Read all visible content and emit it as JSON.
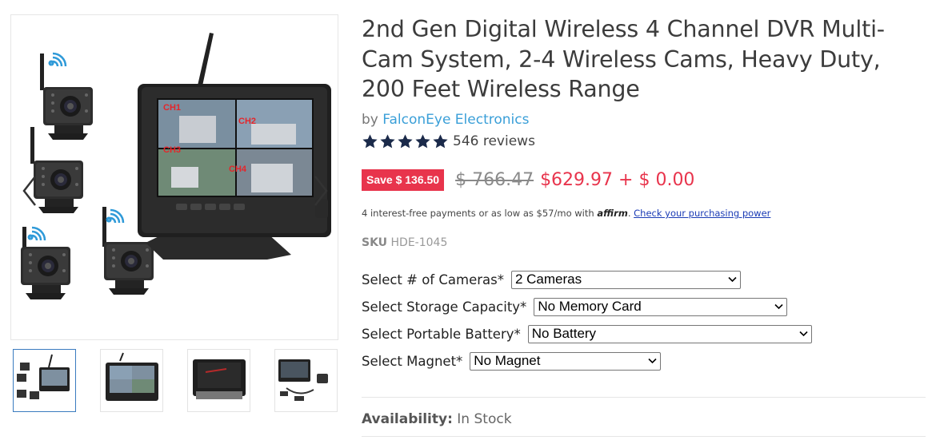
{
  "product": {
    "title": "2nd Gen Digital Wireless 4 Channel DVR Multi-Cam System, 2-4 Wireless Cams, Heavy Duty, 200 Feet Wireless Range",
    "vendor_prefix": "by",
    "vendor": "FalconEye Electronics",
    "rating": 5,
    "reviews": "546 reviews",
    "save_badge": "Save $ 136.50",
    "compare_price": "$ 766.47",
    "price": "$629.97 + $ 0.00",
    "affirm_text": "4 interest-free payments or as low as $57/mo with",
    "affirm_brand": "affirm",
    "affirm_link": "Check your purchasing power",
    "sku_label": "SKU",
    "sku_value": "HDE-1045",
    "availability_label": "Availability:",
    "availability_value": "In Stock"
  },
  "monitor_labels": [
    "CH1",
    "CH2",
    "CH3",
    "CH4"
  ],
  "options": [
    {
      "label": "Select # of Cameras*",
      "value": "2 Cameras"
    },
    {
      "label": "Select Storage Capacity*",
      "value": "No Memory Card"
    },
    {
      "label": "Select Portable Battery*",
      "value": "No Battery"
    },
    {
      "label": "Select Magnet*",
      "value": "No Magnet"
    }
  ],
  "thumbnails": [
    "thumbnail-1",
    "thumbnail-2",
    "thumbnail-3",
    "thumbnail-4"
  ],
  "colors": {
    "accent": "#3a9fd8",
    "sale": "#e8344c",
    "star": "#1b2a4a",
    "thumb_active": "#3a7bbf",
    "wifi": "#2f9ad8"
  },
  "icons": {
    "prev": "chevron-left-icon",
    "next": "chevron-right-icon",
    "star": "star-icon",
    "dropdown": "chevron-down-icon",
    "wifi": "wifi-signal-icon"
  }
}
